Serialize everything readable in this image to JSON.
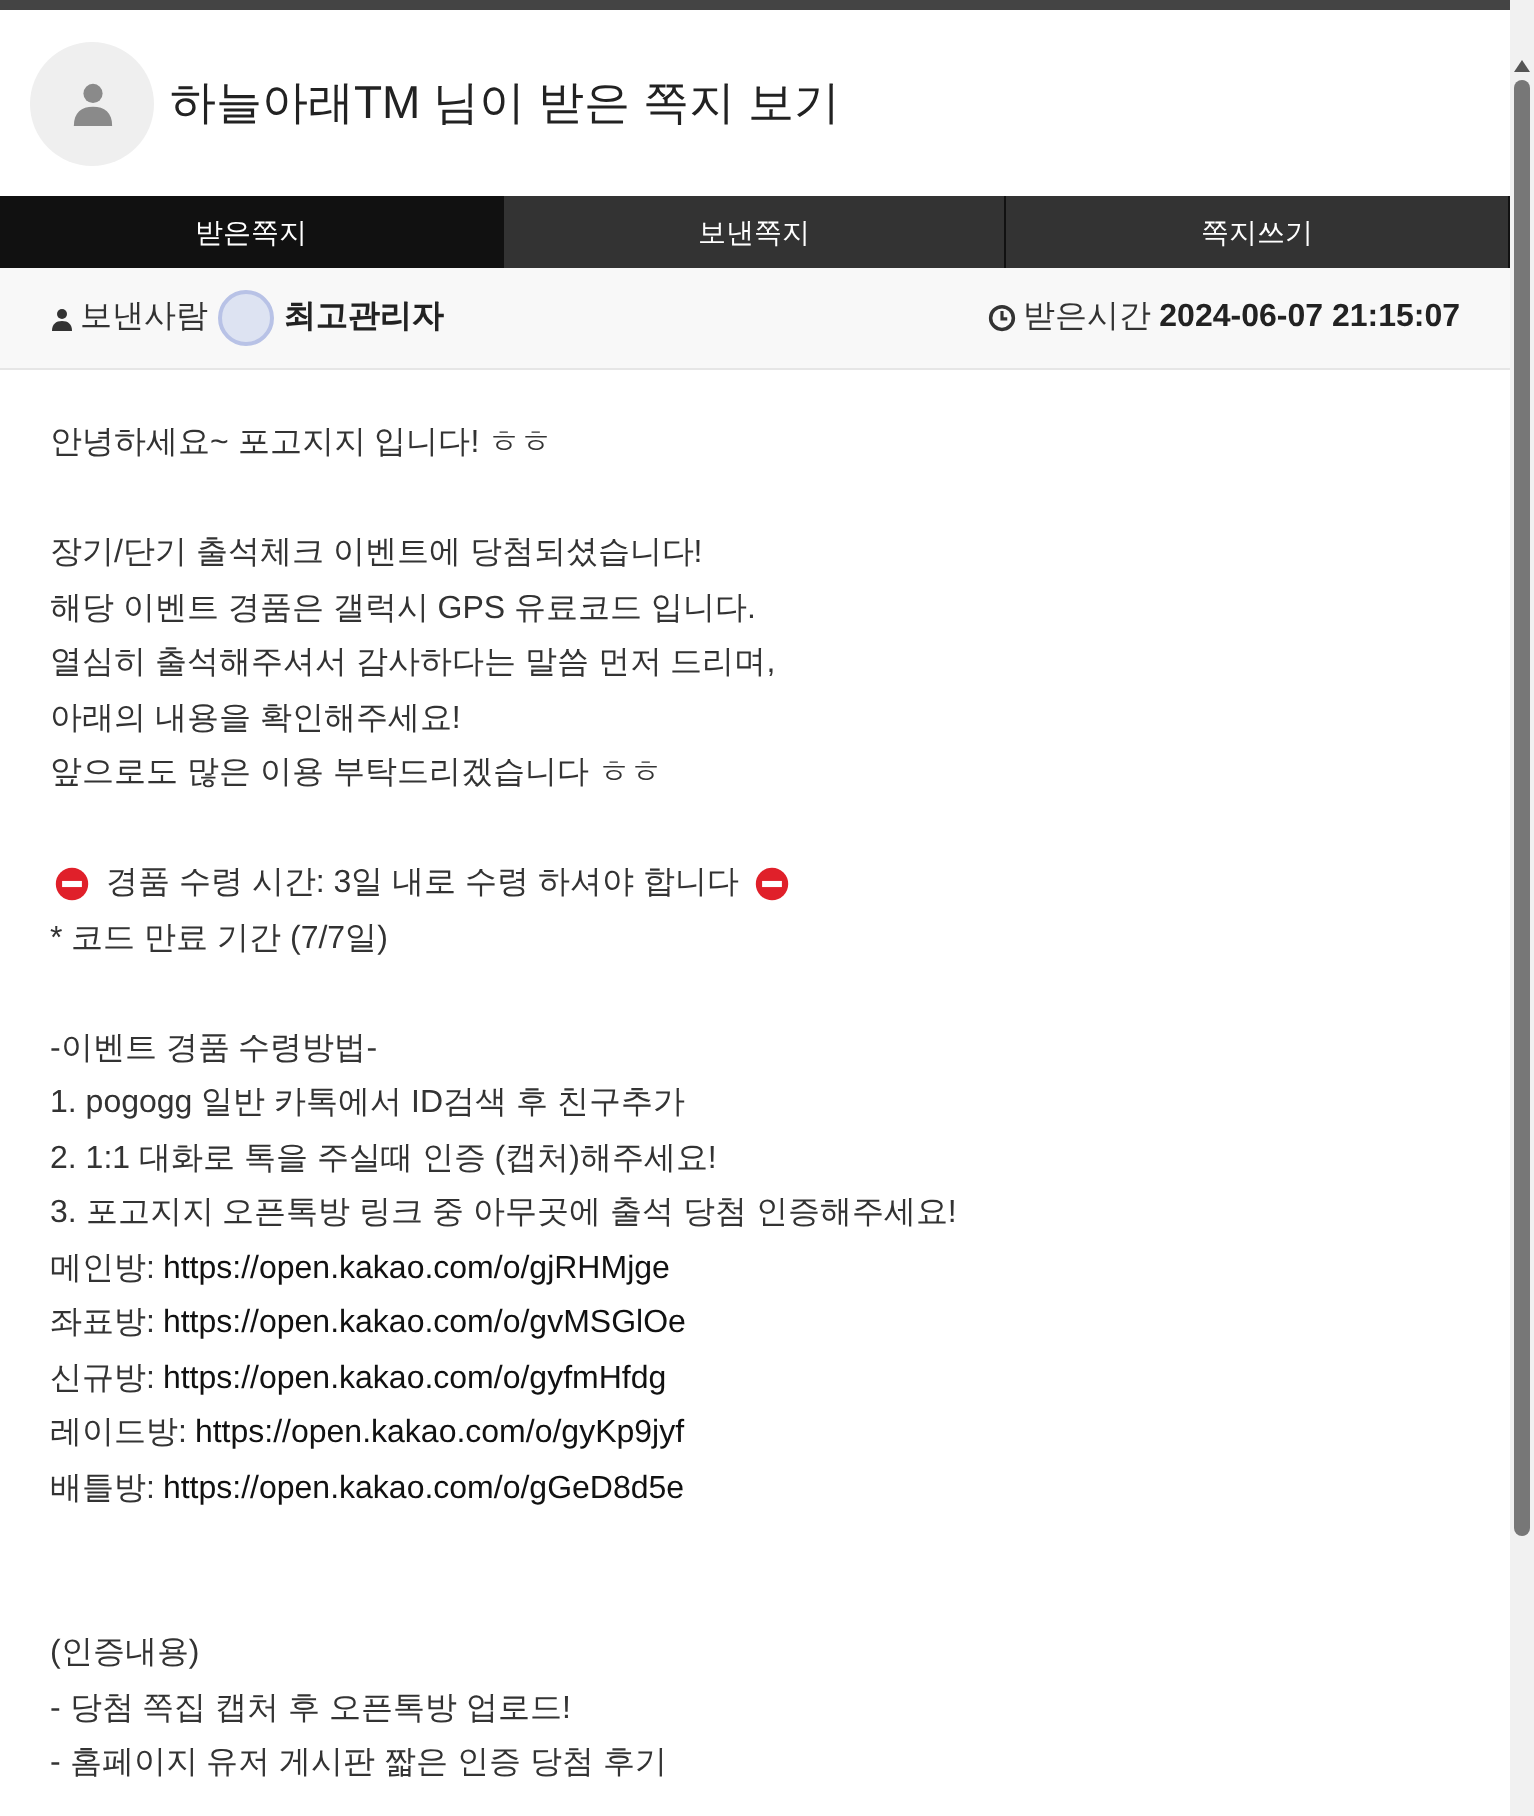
{
  "header": {
    "title": "하늘아래TM 님이 받은 쪽지 보기"
  },
  "tabs": [
    {
      "label": "받은쪽지",
      "selected": true
    },
    {
      "label": "보낸쪽지",
      "selected": false
    },
    {
      "label": "쪽지쓰기",
      "selected": false
    }
  ],
  "info": {
    "sender_label": "보낸사람",
    "sender_name": "최고관리자",
    "time_label": "받은시간",
    "time": "2024-06-07 21:15:07"
  },
  "body": [
    {
      "kind": "text",
      "text": "안녕하세요~ 포고지지 입니다! ㅎㅎ"
    },
    {
      "kind": "gap"
    },
    {
      "kind": "text",
      "text": "장기/단기 출석체크 이벤트에 당첨되셨습니다!"
    },
    {
      "kind": "text",
      "text": "해당 이벤트 경품은 갤럭시 GPS 유료코드 입니다."
    },
    {
      "kind": "text",
      "text": "열심히 출석해주셔서 감사하다는 말씀 먼저 드리며,"
    },
    {
      "kind": "text",
      "text": "아래의 내용을 확인해주세요!"
    },
    {
      "kind": "text",
      "text": "앞으로도 많은 이용 부탁드리겠습니다 ㅎㅎ"
    },
    {
      "kind": "gap"
    },
    {
      "kind": "warning",
      "text": "경품 수령 시간: 3일 내로 수령 하셔야 합니다"
    },
    {
      "kind": "text",
      "text": "* 코드 만료 기간 (7/7일)"
    },
    {
      "kind": "gap"
    },
    {
      "kind": "text",
      "text": "-이벤트 경품 수령방법-"
    },
    {
      "kind": "text",
      "text": "1. pogogg 일반 카톡에서 ID검색 후 친구추가"
    },
    {
      "kind": "text",
      "text": "2. 1:1 대화로 톡을 주실때 인증 (캡처)해주세요!"
    },
    {
      "kind": "text",
      "text": "3. 포고지지 오픈톡방 링크 중 아무곳에 출석 당첨 인증해주세요!"
    },
    {
      "kind": "link",
      "label": "메인방:",
      "url": "https://open.kakao.com/o/gjRHMjge"
    },
    {
      "kind": "link",
      "label": "좌표방:",
      "url": "https://open.kakao.com/o/gvMSGlOe"
    },
    {
      "kind": "link",
      "label": "신규방:",
      "url": "https://open.kakao.com/o/gyfmHfdg"
    },
    {
      "kind": "link",
      "label": "레이드방:",
      "url": "https://open.kakao.com/o/gyKp9jyf"
    },
    {
      "kind": "link",
      "label": "배틀방:",
      "url": "https://open.kakao.com/o/gGeD8d5e"
    },
    {
      "kind": "gap"
    },
    {
      "kind": "gap"
    },
    {
      "kind": "text",
      "text": "(인증내용)"
    },
    {
      "kind": "text",
      "text": "- 당첨 쪽집 캡처 후 오픈톡방 업로드!"
    },
    {
      "kind": "text",
      "text": "- 홈페이지 유저 게시판 짧은 인증 당첨 후기"
    }
  ]
}
